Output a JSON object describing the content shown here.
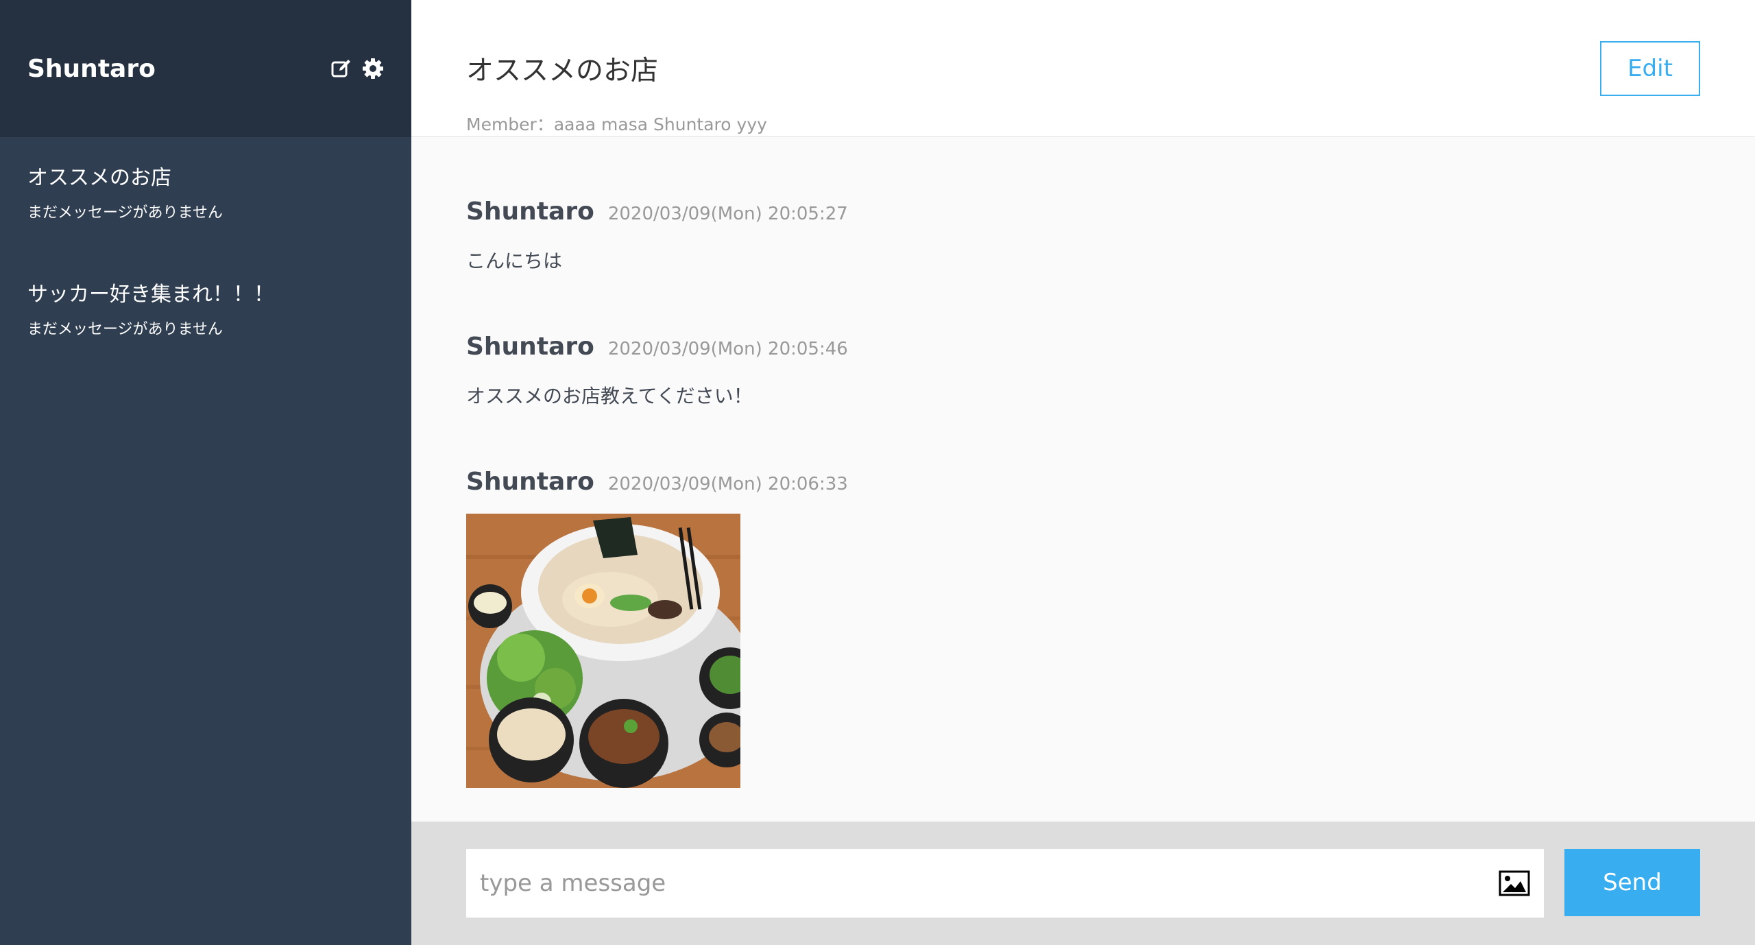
{
  "sidebar": {
    "user_name": "Shuntaro",
    "groups": [
      {
        "name": "オススメのお店",
        "latest_message": "まだメッセージがありません"
      },
      {
        "name": "サッカー好き集まれ！！！",
        "latest_message": "まだメッセージがありません"
      }
    ]
  },
  "header": {
    "group_title": "オススメのお店",
    "members": "Member：aaaa masa Shuntaro yyy",
    "edit_label": "Edit"
  },
  "messages": [
    {
      "user": "Shuntaro",
      "date": "2020/03/09(Mon) 20:05:27",
      "text": "こんにちは"
    },
    {
      "user": "Shuntaro",
      "date": "2020/03/09(Mon) 20:05:46",
      "text": "オススメのお店教えてください！"
    },
    {
      "user": "Shuntaro",
      "date": "2020/03/09(Mon) 20:06:33",
      "image": "ramen-photo"
    }
  ],
  "form": {
    "placeholder": "type a message",
    "image_icon": "image-icon",
    "send_label": "Send"
  },
  "colors": {
    "sidebar_bg": "#2f3e51",
    "sidebar_header_bg": "#253141",
    "accent": "#38aef0",
    "form_bg": "#dddddd"
  }
}
